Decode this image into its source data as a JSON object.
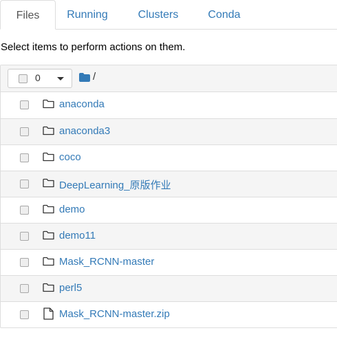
{
  "tabs": [
    {
      "label": "Files",
      "active": true
    },
    {
      "label": "Running",
      "active": false
    },
    {
      "label": "Clusters",
      "active": false
    },
    {
      "label": "Conda",
      "active": false
    }
  ],
  "instructions": "Select items to perform actions on them.",
  "header": {
    "selected_count": "0",
    "breadcrumb": "/"
  },
  "items": [
    {
      "name": "anaconda",
      "type": "folder"
    },
    {
      "name": "anaconda3",
      "type": "folder"
    },
    {
      "name": "coco",
      "type": "folder"
    },
    {
      "name": "DeepLearning_原版作业",
      "type": "folder"
    },
    {
      "name": "demo",
      "type": "folder"
    },
    {
      "name": "demo11",
      "type": "folder"
    },
    {
      "name": "Mask_RCNN-master",
      "type": "folder"
    },
    {
      "name": "perl5",
      "type": "folder"
    },
    {
      "name": "Mask_RCNN-master.zip",
      "type": "file"
    }
  ],
  "colors": {
    "link": "#337ab7",
    "header_bg": "#f5f5f5",
    "folder_head_icon": "#337ab7"
  }
}
